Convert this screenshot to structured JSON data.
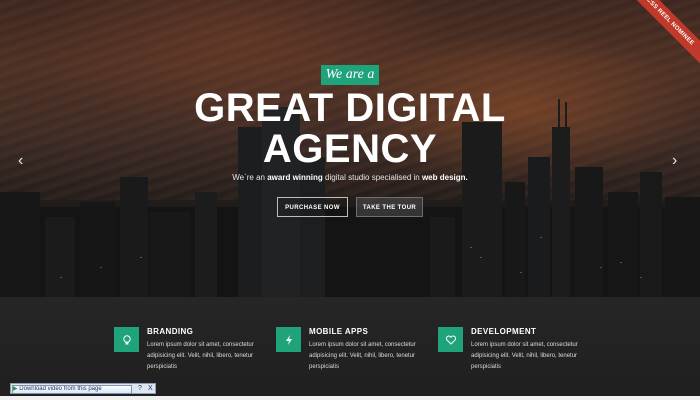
{
  "hero": {
    "ribbon": "CSS REEL NOMINEE",
    "pre_title": "We are a",
    "title_line1": "GREAT DIGITAL",
    "title_line2": "AGENCY",
    "subtitle_start": "We`re an ",
    "subtitle_bold1": "award winning",
    "subtitle_mid": " digital studio specialised in ",
    "subtitle_bold2": "web design.",
    "buttons": {
      "purchase": "PURCHASE NOW",
      "tour": "TAKE THE TOUR"
    },
    "prev_arrow": "‹",
    "next_arrow": "›"
  },
  "features": [
    {
      "icon": "lightbulb-icon",
      "title": "BRANDING",
      "text": "Lorem ipsum dolor sit amet, consectetur adipisicing elit. Velit, nihil, libero, tenetur perspiciatis"
    },
    {
      "icon": "lightning-icon",
      "title": "MOBILE APPS",
      "text": "Lorem ipsum dolor sit amet, consectetur adipisicing elit. Velit, nihil, libero, tenetur perspiciatis"
    },
    {
      "icon": "heart-icon",
      "title": "DEVELOPMENT",
      "text": "Lorem ipsum dolor sit amet, consectetur adipisicing elit. Velit, nihil, libero, tenetur perspiciatis"
    }
  ],
  "download_bar": {
    "label": "Download video from this page",
    "help": "?",
    "close": "X"
  },
  "colors": {
    "accent": "#1fa37b",
    "ribbon": "#c0392b",
    "features_bg": "#232323"
  }
}
